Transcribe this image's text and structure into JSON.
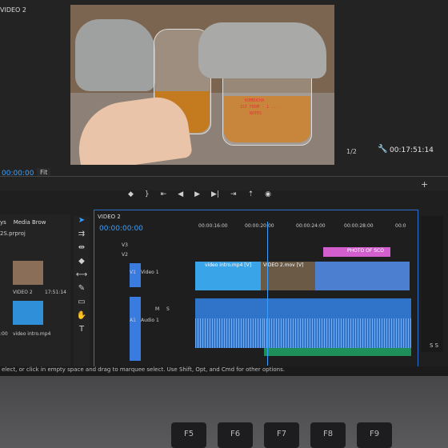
{
  "program_monitor": {
    "tab_label": "VIDEO 2",
    "timecode_left": "00:00:00",
    "fit_label": "Fit",
    "scale_label": "1/2",
    "timecode_right": "00:17:51:14",
    "jar_label_lines": [
      "KOMBUCHA",
      "1ST FERM - 1 ...",
      "NOTES"
    ]
  },
  "project_panel": {
    "tabs": [
      "ys",
      "Media Brow"
    ],
    "file": "2S.prproj",
    "thumbs": [
      {
        "label": "VIDEO 2",
        "duration": "17:51:14"
      },
      {
        "label": "video intro.mp4",
        "duration": ":00"
      }
    ]
  },
  "timeline": {
    "title": "VIDEO 2",
    "timecode": "00:00:00:00",
    "ruler_labels": [
      "00:00:16:00",
      "00:00:20:00",
      "00:00:24:00",
      "00:00:28:00",
      "00:0"
    ],
    "tracks": {
      "v3": "V3",
      "v2": "V2",
      "v1": "V1",
      "v1_name": "Video 1",
      "a1": "A1",
      "a1_name": "Audio 1",
      "m": "M",
      "s": "S"
    },
    "clips": {
      "video_intro": "video intro.mp4 [V]",
      "video2": "VIDEO 2.mov [V]",
      "photo_text": "PHOTO OF SCO"
    }
  },
  "status_bar": "elect, or click in empty space and drag to marquee select. Use Shift, Opt, and Cmd for other options.",
  "meter_label": "S S",
  "keyboard": {
    "keys": [
      "F5",
      "F6",
      "F7",
      "F8",
      "F9"
    ]
  },
  "colors": {
    "accent_blue": "#3aa0ff",
    "timeline_border": "#2f6fd0",
    "audio_clip": "#2f74c9",
    "video_clip_pink": "#d35fcf"
  }
}
